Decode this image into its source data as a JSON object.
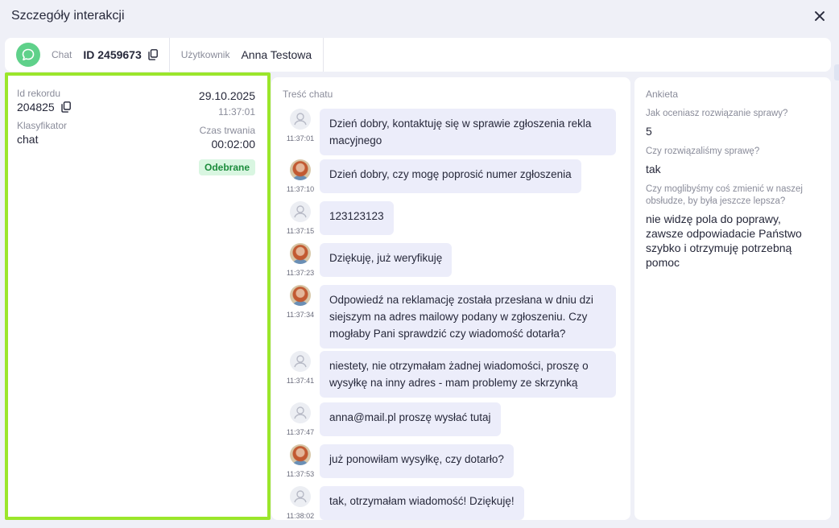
{
  "window": {
    "title": "Szczegóły interakcji"
  },
  "info": {
    "channel_label": "Chat",
    "id": "ID 2459673",
    "user_label": "Użytkownik",
    "user_name": "Anna Testowa"
  },
  "record": {
    "id_label": "Id rekordu",
    "id_value": "204825",
    "classifier_label": "Klasyfikator",
    "classifier_value": "chat",
    "date": "29.10.2025",
    "time": "11:37:01",
    "duration_label": "Czas trwania",
    "duration_value": "00:02:00",
    "status": "Odebrane",
    "status_color": "#1c8c3c"
  },
  "chat": {
    "heading": "Treść chatu",
    "messages": [
      {
        "who": "user",
        "time": "11:37:01",
        "text": "Dzień dobry, kontaktuję się w sprawie zgłoszenia rekla macyjnego"
      },
      {
        "who": "agent",
        "time": "11:37:10",
        "text": "Dzień dobry, czy mogę poprosić numer zgłoszenia"
      },
      {
        "who": "user",
        "time": "11:37:15",
        "text": "123123123"
      },
      {
        "who": "agent",
        "time": "11:37:23",
        "text": "Dziękuję, już weryfikuję"
      },
      {
        "who": "agent",
        "time": "11:37:34",
        "text": "Odpowiedź na reklamację została przesłana w dniu dzi siejszym na adres mailowy podany w zgłoszeniu. Czy mogłaby Pani sprawdzić czy wiadomość dotarła?"
      },
      {
        "who": "user",
        "time": "11:37:41",
        "text": "niestety, nie otrzymałam żadnej wiadomości, proszę o wysyłkę na inny adres - mam problemy ze skrzynką"
      },
      {
        "who": "user",
        "time": "11:37:47",
        "text": "anna@mail.pl proszę wysłać tutaj"
      },
      {
        "who": "agent",
        "time": "11:37:53",
        "text": "już ponowiłam wysyłkę, czy dotarło?"
      },
      {
        "who": "user",
        "time": "11:38:02",
        "text": "tak, otrzymałam wiadomość! Dziękuję!"
      }
    ]
  },
  "survey": {
    "heading": "Ankieta",
    "items": [
      {
        "question": "Jak oceniasz rozwiązanie sprawy?",
        "answer": "5"
      },
      {
        "question": "Czy rozwiązaliśmy sprawę?",
        "answer": "tak"
      },
      {
        "question": "Czy moglibyśmy coś zmienić w naszej obsłudze, by była jeszcze lepsza?",
        "answer": "nie widzę pola do poprawy, zawsze odpowiadacie Państwo szybko i otrzymuję potrzebną pomoc"
      }
    ]
  },
  "colors": {
    "accent_green": "#9be62b",
    "chat_icon": "#5fd18a",
    "bubble": "#ecedfa"
  }
}
